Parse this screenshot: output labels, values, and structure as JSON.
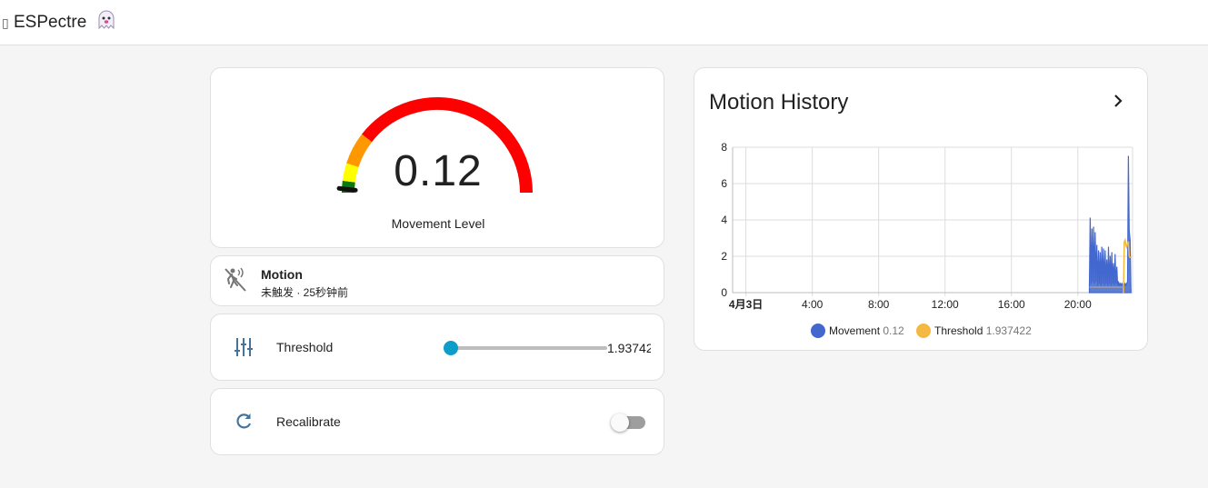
{
  "app": {
    "title": "ESPectre"
  },
  "gauge": {
    "value": "0.12",
    "label": "Movement Level",
    "min": 0,
    "max": 10,
    "level": 0.12
  },
  "motion": {
    "name": "Motion",
    "state": "未触发 · 25秒钟前"
  },
  "threshold": {
    "label": "Threshold",
    "value": "1.93742",
    "level": 0.01
  },
  "recalibrate": {
    "label": "Recalibrate",
    "on": false
  },
  "history": {
    "title": "Motion History",
    "legend": [
      {
        "name": "Movement",
        "value": "0.12",
        "color": "#4267cf"
      },
      {
        "name": "Threshold",
        "value": "1.937422",
        "color": "#f4b942"
      }
    ]
  },
  "chart_data": {
    "type": "line",
    "title": "Motion History",
    "x_ticks": [
      "4月3日",
      "4:00",
      "8:00",
      "12:00",
      "16:00",
      "20:00"
    ],
    "x_tick_hours": [
      0,
      4,
      8,
      12,
      16,
      20
    ],
    "xlim_hours": [
      -0.8,
      23.3
    ],
    "ylim": [
      0,
      8
    ],
    "y_ticks": [
      0,
      2,
      4,
      6,
      8
    ],
    "grid": true,
    "legend_position": "bottom",
    "series": [
      {
        "name": "Movement",
        "color": "#4267cf",
        "x_hours": [
          20.7,
          20.75,
          20.8,
          20.85,
          20.9,
          20.95,
          21.0,
          21.05,
          21.1,
          21.15,
          21.2,
          21.25,
          21.3,
          21.35,
          21.4,
          21.45,
          21.5,
          21.55,
          21.6,
          21.65,
          21.7,
          21.75,
          21.8,
          21.85,
          21.9,
          21.95,
          22.0,
          22.05,
          22.1,
          22.15,
          22.2,
          22.25,
          22.3,
          22.35,
          22.4,
          22.45,
          22.5,
          22.55,
          22.6,
          22.65,
          22.7,
          22.75,
          22.8,
          22.85,
          22.9,
          22.95,
          23.0,
          23.05,
          23.1,
          23.15,
          23.2
        ],
        "values": [
          0.4,
          4.1,
          0.5,
          3.5,
          0.6,
          3.6,
          0.5,
          3.3,
          0.6,
          2.6,
          0.4,
          2.3,
          0.5,
          2.2,
          0.4,
          2.5,
          0.5,
          2.4,
          0.4,
          2.3,
          0.5,
          1.8,
          0.4,
          2.5,
          0.5,
          2.0,
          0.4,
          2.2,
          0.5,
          1.6,
          0.4,
          2.1,
          0.5,
          1.4,
          0.4,
          0.6,
          0.4,
          0.5,
          0.4,
          0.5,
          0.4,
          0.5,
          0.4,
          0.5,
          0.4,
          0.5,
          0.6,
          7.5,
          3.4,
          2.9,
          0.12
        ]
      },
      {
        "name": "Threshold",
        "color": "#f4b942",
        "x_hours": [
          22.75,
          22.8,
          22.85,
          22.9,
          22.95,
          23.0,
          23.05,
          23.1,
          23.15,
          23.2
        ],
        "values": [
          0.0,
          2.8,
          2.9,
          2.6,
          2.5,
          2.7,
          2.8,
          2.0,
          1.94,
          1.94
        ]
      }
    ]
  }
}
